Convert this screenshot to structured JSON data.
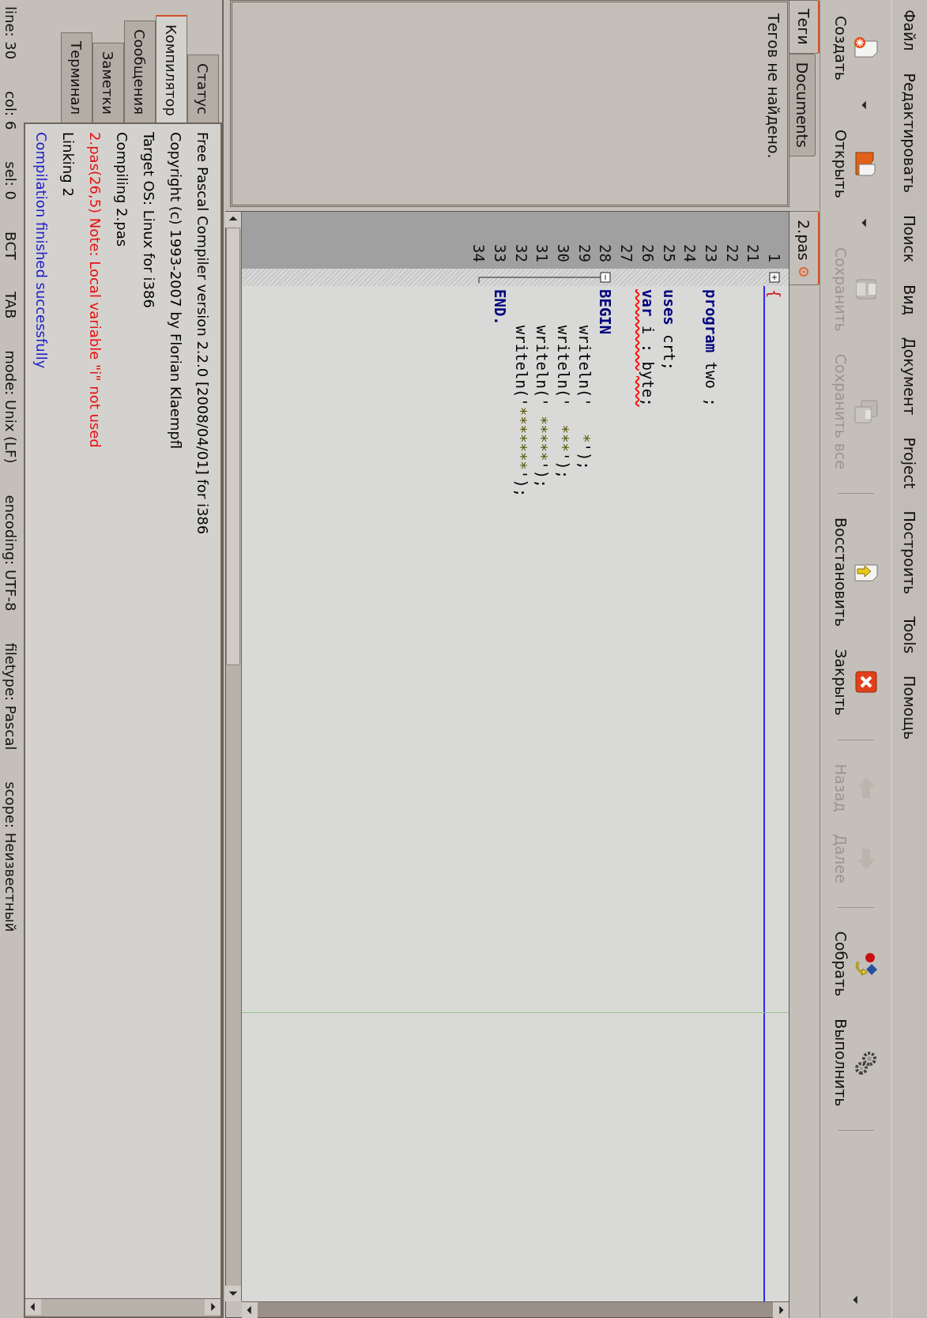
{
  "menu": [
    "Файл",
    "Редактировать",
    "Поиск",
    "Вид",
    "Документ",
    "Project",
    "Построить",
    "Tools",
    "Помощь"
  ],
  "toolbar": [
    {
      "kind": "new",
      "label": "Создать",
      "disabled": false
    },
    {
      "kind": "dropdown"
    },
    {
      "kind": "open",
      "label": "Открыть",
      "disabled": false
    },
    {
      "kind": "dropdown"
    },
    {
      "kind": "save",
      "label": "Сохранить",
      "disabled": true
    },
    {
      "kind": "save-all",
      "label": "Сохранить все",
      "disabled": true
    },
    {
      "kind": "separator"
    },
    {
      "kind": "revert",
      "label": "Восстановить",
      "disabled": false
    },
    {
      "kind": "close",
      "label": "Закрыть",
      "disabled": false
    },
    {
      "kind": "separator"
    },
    {
      "kind": "back",
      "label": "Назад",
      "disabled": true
    },
    {
      "kind": "forward",
      "label": "Далее",
      "disabled": true
    },
    {
      "kind": "separator"
    },
    {
      "kind": "build",
      "label": "Собрать",
      "disabled": false
    },
    {
      "kind": "run",
      "label": "Выполнить",
      "disabled": false
    },
    {
      "kind": "separator"
    },
    {
      "kind": "overflow"
    }
  ],
  "sidebar": {
    "tabs": [
      {
        "label": "Теги",
        "selected": true
      },
      {
        "label": "Documents",
        "selected": false
      }
    ],
    "message": "Тегов не найдено."
  },
  "editor": {
    "tabs": [
      {
        "label": "2.pas",
        "selected": true
      }
    ],
    "lines": [
      {
        "number": "1",
        "expanded": false,
        "squiggle": false,
        "tokens": [
          {
            "kind": "comment",
            "text": "{"
          }
        ]
      },
      {
        "number": "21"
      },
      {
        "number": "22"
      },
      {
        "number": "23",
        "squiggle": false,
        "tokens": [
          {
            "kind": "keyword",
            "text": "program"
          },
          {
            "kind": "plain",
            "text": " two ;"
          }
        ]
      },
      {
        "number": "24"
      },
      {
        "number": "25",
        "squiggle": false,
        "tokens": [
          {
            "kind": "keyword",
            "text": "uses"
          },
          {
            "kind": "plain",
            "text": " crt;"
          }
        ]
      },
      {
        "number": "26",
        "squiggle": true,
        "tokens": [
          {
            "kind": "keyword",
            "text": "var"
          },
          {
            "kind": "plain",
            "text": " i : byte;"
          }
        ]
      },
      {
        "number": "27"
      },
      {
        "number": "28",
        "expanded": true,
        "squiggle": false,
        "tokens": [
          {
            "kind": "keyword",
            "text": "BEGIN"
          }
        ],
        "children": [
          {
            "number": "29",
            "squiggle": false,
            "tokens": [
              {
                "kind": "plain",
                "text": "    writeln('   "
              },
              {
                "kind": "string",
                "text": "*"
              },
              {
                "kind": "plain",
                "text": "');"
              }
            ]
          },
          {
            "number": "30",
            "squiggle": false,
            "tokens": [
              {
                "kind": "plain",
                "text": "    writeln('  "
              },
              {
                "kind": "string",
                "text": "***"
              },
              {
                "kind": "plain",
                "text": "');"
              }
            ]
          },
          {
            "number": "31",
            "squiggle": false,
            "tokens": [
              {
                "kind": "plain",
                "text": "    writeln(' "
              },
              {
                "kind": "string",
                "text": "*****"
              },
              {
                "kind": "plain",
                "text": "');"
              }
            ]
          },
          {
            "number": "32",
            "squiggle": false,
            "tokens": [
              {
                "kind": "plain",
                "text": "    writeln('"
              },
              {
                "kind": "string",
                "text": "*******"
              },
              {
                "kind": "plain",
                "text": "');"
              }
            ]
          },
          {
            "number": "33",
            "squiggle": false,
            "tokens": [
              {
                "kind": "keyword",
                "text": "END."
              }
            ]
          },
          {
            "number": "34"
          }
        ]
      }
    ]
  },
  "messages": {
    "tabs": [
      {
        "label": "Статус",
        "selected": false
      },
      {
        "label": "Компилятор",
        "selected": true
      },
      {
        "label": "Сообщения",
        "selected": false
      },
      {
        "label": "Заметки",
        "selected": false
      },
      {
        "label": "Терминал",
        "selected": false
      }
    ],
    "lines": [
      {
        "text": "Free Pascal Compiler version 2.2.0 [2008/04/01] for i386",
        "color": "#000000"
      },
      {
        "text": "Copyright (c) 1993-2007 by Florian Klaempfl",
        "color": "#000000"
      },
      {
        "text": "Target OS: Linux for i386",
        "color": "#000000"
      },
      {
        "text": "Compiling 2.pas",
        "color": "#000000"
      },
      {
        "text": "2.pas(26,5) Note: Local variable \"i\" not used",
        "color": "#e81010"
      },
      {
        "text": "Linking 2",
        "color": "#000000"
      },
      {
        "text": "Compilation finished successfully",
        "color": "#1c1cc8"
      }
    ]
  },
  "status_bar": [
    "line: 30",
    "col: 6",
    "sel: 0",
    "ВСТ",
    "TAB",
    "mode: Unix (LF)",
    "encoding: UTF-8",
    "filetype: Pascal",
    "scope: Неизвестный"
  ]
}
